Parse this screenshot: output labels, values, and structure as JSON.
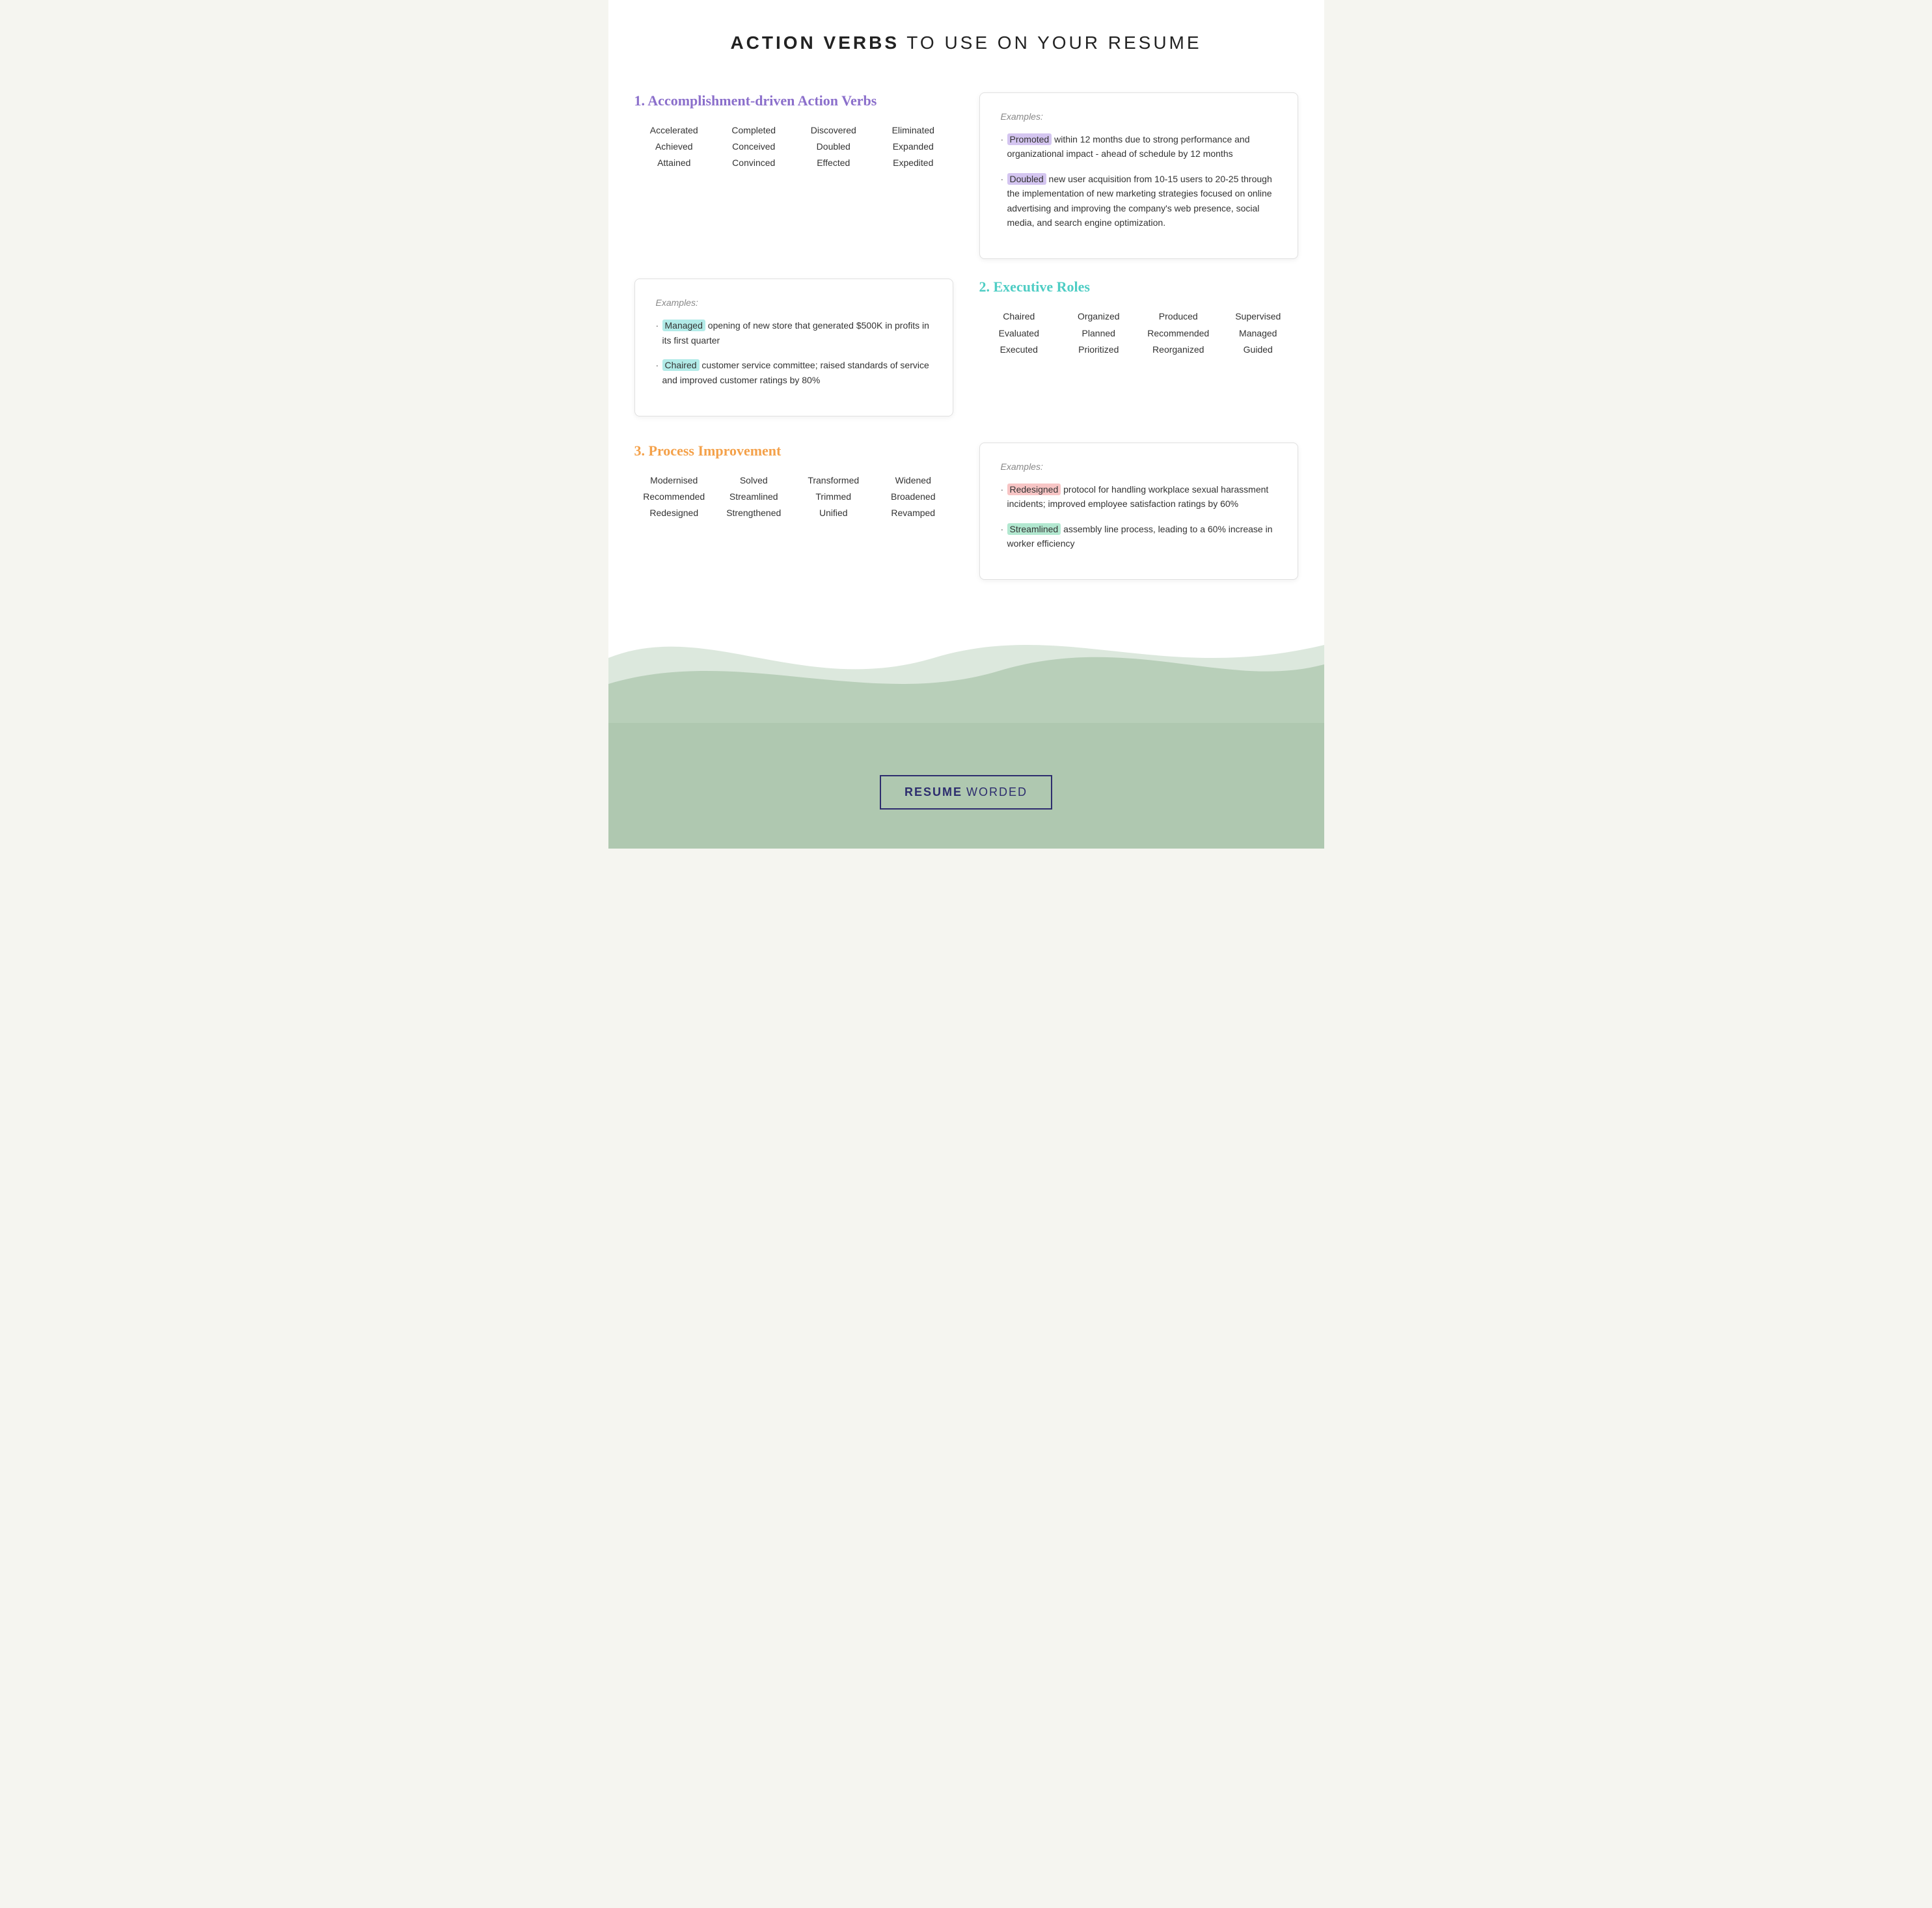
{
  "header": {
    "title_bold": "ACTION VERBS",
    "title_rest": " TO USE ON YOUR RESUME"
  },
  "section1": {
    "heading": "1. Accomplishment-driven Action Verbs",
    "verbs": [
      [
        "Accelerated",
        "Achieved",
        "Attained"
      ],
      [
        "Completed",
        "Conceived",
        "Convinced"
      ],
      [
        "Discovered",
        "Doubled",
        "Effected"
      ],
      [
        "Eliminated",
        "Expanded",
        "Expedited"
      ]
    ],
    "example_label": "Examples:",
    "examples": [
      {
        "highlight": "Promoted",
        "highlight_class": "highlight-purple",
        "text": " within 12 months due to strong performance and organizational impact - ahead of schedule by 12 months"
      },
      {
        "highlight": "Doubled",
        "highlight_class": "highlight-purple",
        "text": " new user acquisition from 10-15 users to 20-25 through the implementation of new marketing strategies focused on online advertising and improving the company's web presence, social media, and search engine optimization."
      }
    ]
  },
  "section1_examples_left": {
    "example_label": "Examples:",
    "examples": [
      {
        "highlight": "Managed",
        "highlight_class": "highlight-teal",
        "text": " opening of new store that generated $500K in profits in its first quarter"
      },
      {
        "highlight": "Chaired",
        "highlight_class": "highlight-teal",
        "text": " customer service committee; raised standards of service and improved customer ratings by 80%"
      }
    ]
  },
  "section2": {
    "heading": "2. Executive Roles",
    "verbs": [
      [
        "Chaired",
        "Evaluated",
        "Executed"
      ],
      [
        "Organized",
        "Planned",
        "Prioritized"
      ],
      [
        "Produced",
        "Recommended",
        "Reorganized"
      ],
      [
        "Supervised",
        "Managed",
        "Guided"
      ]
    ]
  },
  "section3": {
    "heading": "3. Process Improvement",
    "verbs": [
      [
        "Modernised",
        "Recommended",
        "Redesigned"
      ],
      [
        "Solved",
        "Streamlined",
        "Strengthened"
      ],
      [
        "Transformed",
        "Trimmed",
        "Unified"
      ],
      [
        "Widened",
        "Broadened",
        "Revamped"
      ]
    ],
    "example_label": "Examples:",
    "examples": [
      {
        "highlight": "Redesigned",
        "highlight_class": "highlight-pink",
        "text": " protocol for handling workplace sexual harassment incidents; improved employee satisfaction ratings by 60%"
      },
      {
        "highlight": "Streamlined",
        "highlight_class": "highlight-green",
        "text": " assembly line process, leading to a 60% increase in worker efficiency"
      }
    ]
  },
  "brand": {
    "resume": "RESUME",
    "worded": "WORDED"
  }
}
